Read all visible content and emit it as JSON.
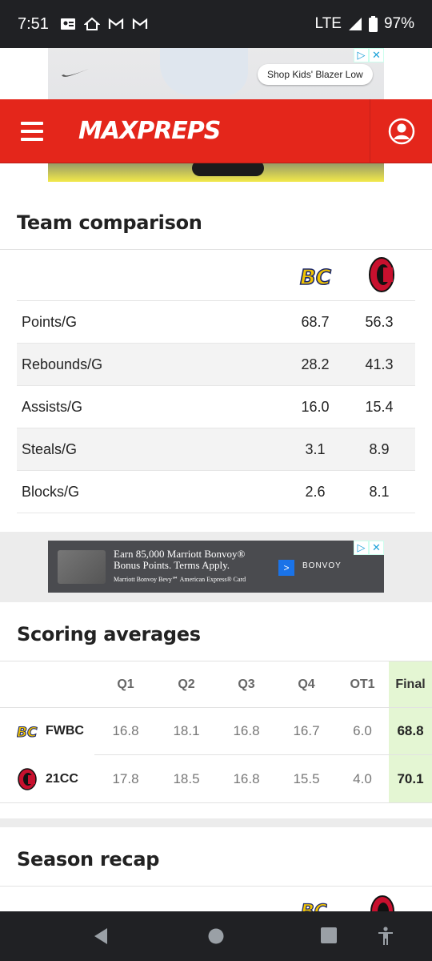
{
  "status_bar": {
    "time": "7:51",
    "network": "LTE",
    "battery": "97%"
  },
  "ad_top": {
    "cta": "Shop Kids' Blazer Low"
  },
  "header": {
    "logo": "MAXPREPS"
  },
  "team_comparison": {
    "title": "Team comparison",
    "rows": [
      {
        "label": "Points/G",
        "team1": "68.7",
        "team2": "56.3"
      },
      {
        "label": "Rebounds/G",
        "team1": "28.2",
        "team2": "41.3"
      },
      {
        "label": "Assists/G",
        "team1": "16.0",
        "team2": "15.4"
      },
      {
        "label": "Steals/G",
        "team1": "3.1",
        "team2": "8.9"
      },
      {
        "label": "Blocks/G",
        "team1": "2.6",
        "team2": "8.1"
      }
    ]
  },
  "ad_mid": {
    "line1": "Earn 85,000 Marriott Bonvoy® Bonus Points. Terms Apply.",
    "line2": "Marriott Bonvoy Bevy℠ American Express® Card",
    "brand": "BONVOY"
  },
  "scoring_averages": {
    "title": "Scoring averages",
    "columns": [
      "Q1",
      "Q2",
      "Q3",
      "Q4",
      "OT1",
      "Final"
    ],
    "rows": [
      {
        "team": "FWBC",
        "values": [
          "16.8",
          "18.1",
          "16.8",
          "16.7",
          "6.0"
        ],
        "final": "68.8"
      },
      {
        "team": "21CC",
        "values": [
          "17.8",
          "18.5",
          "16.8",
          "15.5",
          "4.0"
        ],
        "final": "70.1"
      }
    ]
  },
  "season_recap": {
    "title": "Season recap"
  },
  "colors": {
    "brand_red": "#e4261b",
    "final_highlight": "#e4f6d3",
    "team1_gold": "#f2c400",
    "team1_navy": "#1e2a6b",
    "team2_red": "#c8102e"
  },
  "icons": [
    "hamburger-menu-icon",
    "account-icon",
    "back-icon",
    "home-icon",
    "recents-icon",
    "accessibility-icon"
  ]
}
